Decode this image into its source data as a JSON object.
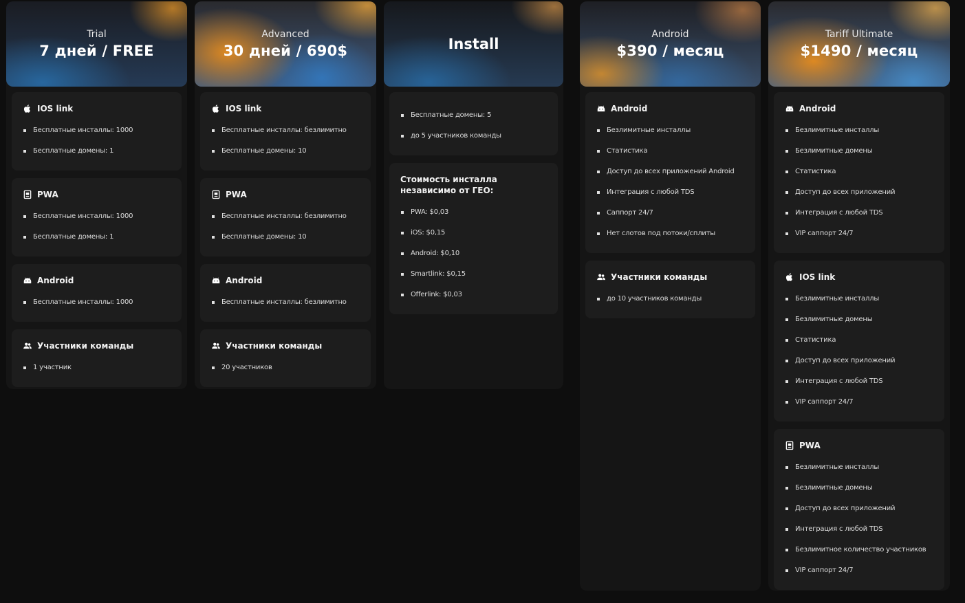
{
  "plans": [
    {
      "name": "Trial",
      "price": "7 дней / FREE",
      "blocks": [
        {
          "icon": "apple-icon",
          "title": "IOS link",
          "items": [
            "Бесплатные инсталлы: 1000",
            "Бесплатные домены: 1"
          ]
        },
        {
          "icon": "pwa-icon",
          "title": "PWA",
          "items": [
            "Бесплатные инсталлы: 1000",
            "Бесплатные домены: 1"
          ]
        },
        {
          "icon": "android-icon",
          "title": "Android",
          "items": [
            "Бесплатные инсталлы: 1000"
          ]
        },
        {
          "icon": "team-icon",
          "title": "Участники команды",
          "items": [
            "1 участник"
          ]
        }
      ]
    },
    {
      "name": "Advanced",
      "price": "30 дней / 690$",
      "blocks": [
        {
          "icon": "apple-icon",
          "title": "IOS link",
          "items": [
            "Бесплатные инсталлы: безлимитно",
            "Бесплатные домены: 10"
          ]
        },
        {
          "icon": "pwa-icon",
          "title": "PWA",
          "items": [
            "Бесплатные инсталлы: безлимитно",
            "Бесплатные домены: 10"
          ]
        },
        {
          "icon": "android-icon",
          "title": "Android",
          "items": [
            "Бесплатные инсталлы: безлимитно"
          ]
        },
        {
          "icon": "team-icon",
          "title": "Участники команды",
          "items": [
            "20 участников"
          ]
        }
      ]
    },
    {
      "name": "Install",
      "blocks": [
        {
          "items": [
            "Бесплатные домены: 5",
            "до 5 участников команды"
          ]
        },
        {
          "title": "Стоимость инсталла независимо от ГЕО:",
          "items": [
            "PWA: $0,03",
            "iOS: $0,15",
            "Android: $0,10",
            "Smartlink: $0,15",
            "Offerlink: $0,03"
          ]
        }
      ]
    },
    {
      "name": "Android",
      "price": "$390 / месяц",
      "blocks": [
        {
          "icon": "android-icon",
          "title": "Android",
          "items": [
            "Безлимитные инсталлы",
            "Статистика",
            "Доступ до всех приложений Android",
            "Интеграция с любой TDS",
            "Саппорт 24/7",
            "Нет слотов под потоки/сплиты"
          ]
        },
        {
          "icon": "team-icon",
          "title": "Участники команды",
          "items": [
            "до 10 участников команды"
          ]
        }
      ]
    },
    {
      "name": "Tariff Ultimate",
      "price": "$1490 / месяц",
      "blocks": [
        {
          "icon": "android-icon",
          "title": "Android",
          "items": [
            "Безлимитные инсталлы",
            "Безлимитные домены",
            "Статистика",
            "Доступ до всех приложений",
            "Интеграция с любой TDS",
            "VIP саппорт 24/7"
          ]
        },
        {
          "icon": "apple-icon",
          "title": "IOS link",
          "items": [
            "Безлимитные инсталлы",
            "Безлимитные домены",
            "Статистика",
            "Доступ до всех приложений",
            "Интеграция с любой TDS",
            "VIP саппорт 24/7"
          ]
        },
        {
          "icon": "pwa-icon",
          "title": "PWA",
          "items": [
            "Безлимитные инсталлы",
            "Безлимитные домены",
            "Доступ до всех приложений",
            "Интеграция с любой TDS",
            "Безлимитное количество участников",
            "VIP саппорт 24/7"
          ]
        }
      ]
    }
  ]
}
